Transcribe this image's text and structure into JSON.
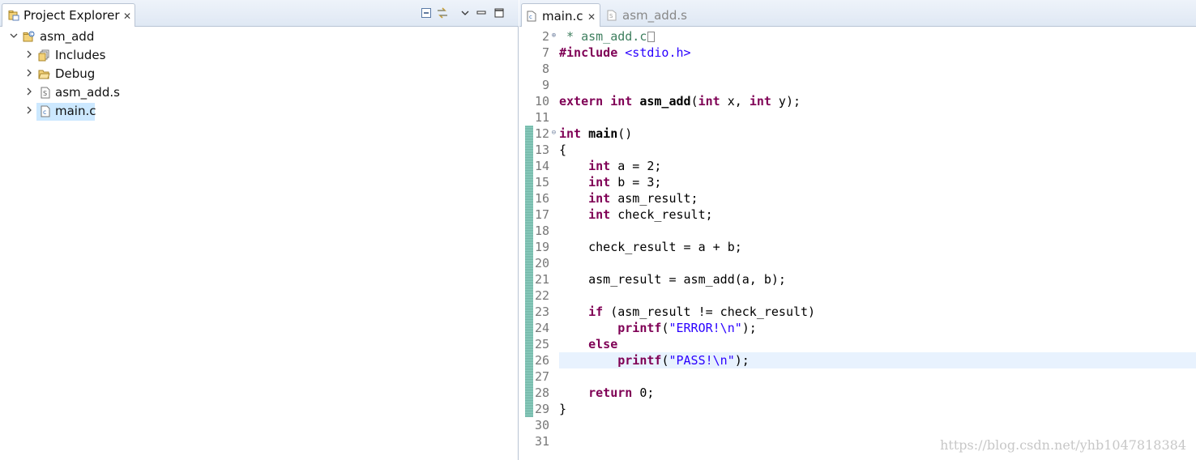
{
  "explorer": {
    "title": "Project Explorer",
    "close_glyph": "✕",
    "tree": [
      {
        "label": "asm_add",
        "icon": "c-project-icon",
        "depth": 0,
        "expanded": true,
        "selected": false
      },
      {
        "label": "Includes",
        "icon": "includes-icon",
        "depth": 1,
        "expanded": false,
        "selected": false
      },
      {
        "label": "Debug",
        "icon": "folder-icon",
        "depth": 1,
        "expanded": false,
        "selected": false
      },
      {
        "label": "asm_add.s",
        "icon": "asm-file-icon",
        "depth": 1,
        "expanded": false,
        "selected": false
      },
      {
        "label": "main.c",
        "icon": "c-file-icon",
        "depth": 1,
        "expanded": false,
        "selected": true
      }
    ]
  },
  "editor": {
    "tabs": [
      {
        "label": "main.c",
        "active": true
      },
      {
        "label": "asm_add.s",
        "active": false
      }
    ],
    "close_glyph": "✕",
    "current_line": 26,
    "lines": [
      {
        "n": "2",
        "fold": "⊕",
        "tokens": [
          {
            "t": " * asm_add.c",
            "c": "cmt"
          }
        ],
        "collapsed": true
      },
      {
        "n": "7",
        "fold": "",
        "tokens": [
          {
            "t": "#include",
            "c": "kw"
          },
          {
            "t": " ",
            "c": ""
          },
          {
            "t": "<stdio.h>",
            "c": "inc"
          }
        ]
      },
      {
        "n": "8",
        "fold": "",
        "tokens": []
      },
      {
        "n": "9",
        "fold": "",
        "tokens": []
      },
      {
        "n": "10",
        "fold": "",
        "tokens": [
          {
            "t": "extern",
            "c": "kw"
          },
          {
            "t": " ",
            "c": ""
          },
          {
            "t": "int",
            "c": "kw"
          },
          {
            "t": " ",
            "c": ""
          },
          {
            "t": "asm_add",
            "c": "fn"
          },
          {
            "t": "(",
            "c": ""
          },
          {
            "t": "int",
            "c": "kw"
          },
          {
            "t": " x, ",
            "c": ""
          },
          {
            "t": "int",
            "c": "kw"
          },
          {
            "t": " y);",
            "c": ""
          }
        ]
      },
      {
        "n": "11",
        "fold": "",
        "tokens": []
      },
      {
        "n": "12",
        "fold": "⊖",
        "tokens": [
          {
            "t": "int",
            "c": "kw"
          },
          {
            "t": " ",
            "c": ""
          },
          {
            "t": "main",
            "c": "fn"
          },
          {
            "t": "()",
            "c": ""
          }
        ]
      },
      {
        "n": "13",
        "fold": "",
        "tokens": [
          {
            "t": "{",
            "c": ""
          }
        ]
      },
      {
        "n": "14",
        "fold": "",
        "tokens": [
          {
            "t": "    ",
            "c": ""
          },
          {
            "t": "int",
            "c": "kw"
          },
          {
            "t": " a = 2;",
            "c": ""
          }
        ]
      },
      {
        "n": "15",
        "fold": "",
        "tokens": [
          {
            "t": "    ",
            "c": ""
          },
          {
            "t": "int",
            "c": "kw"
          },
          {
            "t": " b = 3;",
            "c": ""
          }
        ]
      },
      {
        "n": "16",
        "fold": "",
        "tokens": [
          {
            "t": "    ",
            "c": ""
          },
          {
            "t": "int",
            "c": "kw"
          },
          {
            "t": " asm_result;",
            "c": ""
          }
        ]
      },
      {
        "n": "17",
        "fold": "",
        "tokens": [
          {
            "t": "    ",
            "c": ""
          },
          {
            "t": "int",
            "c": "kw"
          },
          {
            "t": " check_result;",
            "c": ""
          }
        ]
      },
      {
        "n": "18",
        "fold": "",
        "tokens": []
      },
      {
        "n": "19",
        "fold": "",
        "tokens": [
          {
            "t": "    check_result = a + b;",
            "c": ""
          }
        ]
      },
      {
        "n": "20",
        "fold": "",
        "tokens": []
      },
      {
        "n": "21",
        "fold": "",
        "tokens": [
          {
            "t": "    asm_result = asm_add(a, b);",
            "c": ""
          }
        ]
      },
      {
        "n": "22",
        "fold": "",
        "tokens": []
      },
      {
        "n": "23",
        "fold": "",
        "tokens": [
          {
            "t": "    ",
            "c": ""
          },
          {
            "t": "if",
            "c": "kw"
          },
          {
            "t": " (asm_result != check_result)",
            "c": ""
          }
        ]
      },
      {
        "n": "24",
        "fold": "",
        "tokens": [
          {
            "t": "        ",
            "c": ""
          },
          {
            "t": "printf",
            "c": "kw"
          },
          {
            "t": "(",
            "c": ""
          },
          {
            "t": "\"ERROR!\\n\"",
            "c": "str"
          },
          {
            "t": ");",
            "c": ""
          }
        ]
      },
      {
        "n": "25",
        "fold": "",
        "tokens": [
          {
            "t": "    ",
            "c": ""
          },
          {
            "t": "else",
            "c": "kw"
          }
        ]
      },
      {
        "n": "26",
        "fold": "",
        "tokens": [
          {
            "t": "        ",
            "c": ""
          },
          {
            "t": "printf",
            "c": "kw"
          },
          {
            "t": "(",
            "c": ""
          },
          {
            "t": "\"PASS!\\n\"",
            "c": "str"
          },
          {
            "t": ");",
            "c": ""
          }
        ]
      },
      {
        "n": "27",
        "fold": "",
        "tokens": []
      },
      {
        "n": "28",
        "fold": "",
        "tokens": [
          {
            "t": "    ",
            "c": ""
          },
          {
            "t": "return",
            "c": "kw"
          },
          {
            "t": " 0;",
            "c": ""
          }
        ]
      },
      {
        "n": "29",
        "fold": "",
        "tokens": [
          {
            "t": "}",
            "c": ""
          }
        ]
      },
      {
        "n": "30",
        "fold": "",
        "tokens": []
      },
      {
        "n": "31",
        "fold": "",
        "tokens": []
      }
    ]
  },
  "watermark": "https://blog.csdn.net/yhb1047818384",
  "colors": {
    "keyword": "#7f0055",
    "string": "#2a00ff",
    "comment": "#3f7f5f",
    "selection": "#cce8ff",
    "current_line": "#e8f2fe"
  }
}
